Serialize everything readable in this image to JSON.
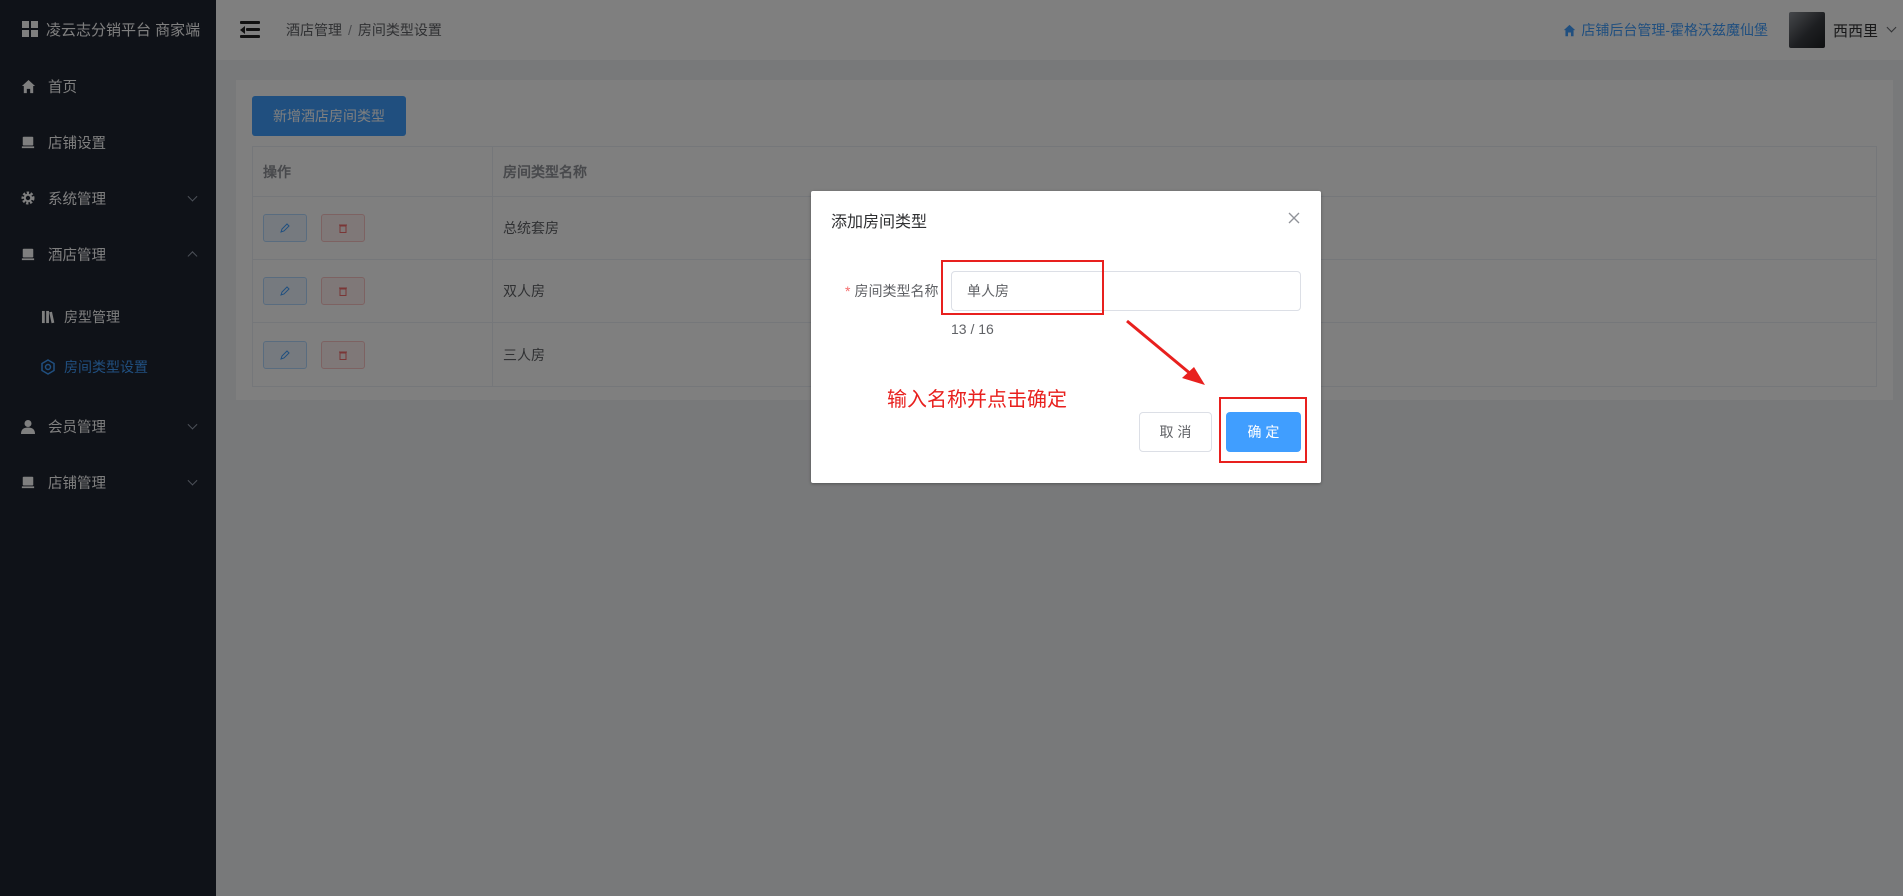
{
  "sidebar": {
    "brand": "凌云志分销平台 商家端",
    "items": [
      {
        "label": "首页",
        "icon": "home-icon"
      },
      {
        "label": "店铺设置",
        "icon": "store-icon"
      },
      {
        "label": "系统管理",
        "icon": "gear-icon"
      },
      {
        "label": "酒店管理",
        "icon": "store-icon"
      }
    ],
    "hotel_sub": [
      {
        "label": "房型管理",
        "icon": "books-icon"
      },
      {
        "label": "房间类型设置",
        "icon": "gear-icon"
      }
    ],
    "items2": [
      {
        "label": "会员管理",
        "icon": "user-icon"
      },
      {
        "label": "店铺管理",
        "icon": "store-icon"
      }
    ]
  },
  "header": {
    "breadcrumb": [
      "酒店管理",
      "房间类型设置"
    ],
    "shop_link": "店铺后台管理-霍格沃兹魔仙堡",
    "username": "西西里"
  },
  "main": {
    "add_button": "新增酒店房间类型",
    "columns": [
      "操作",
      "房间类型名称"
    ],
    "rows": [
      {
        "name": "总统套房"
      },
      {
        "name": "双人房"
      },
      {
        "name": "三人房"
      }
    ]
  },
  "dialog": {
    "title": "添加房间类型",
    "field_label": "房间类型名称",
    "field_value": "单人房",
    "counter": "13 / 16",
    "cancel": "取 消",
    "confirm": "确 定"
  },
  "annotation": {
    "text": "输入名称并点击确定",
    "color": "#e8201e"
  },
  "colors": {
    "primary": "#409eff",
    "sidebar_bg": "#1f2430",
    "danger": "#f56c6c"
  }
}
